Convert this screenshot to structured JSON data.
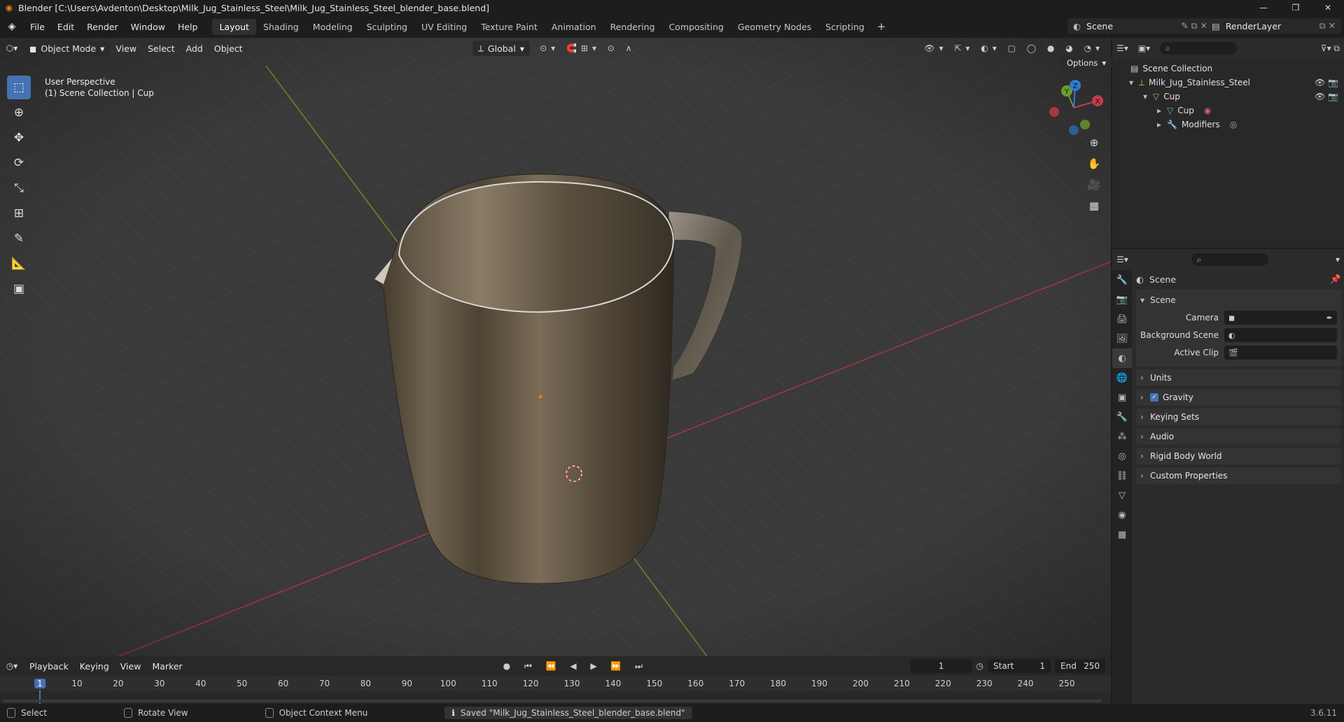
{
  "window": {
    "title": "Blender [C:\\Users\\Avdenton\\Desktop\\Milk_Jug_Stainless_Steel\\Milk_Jug_Stainless_Steel_blender_base.blend]",
    "controls": [
      "—",
      "❐",
      "✕"
    ]
  },
  "menu": [
    "File",
    "Edit",
    "Render",
    "Window",
    "Help"
  ],
  "workspaces": [
    "Layout",
    "Shading",
    "Modeling",
    "Sculpting",
    "UV Editing",
    "Texture Paint",
    "Animation",
    "Rendering",
    "Compositing",
    "Geometry Nodes",
    "Scripting"
  ],
  "active_workspace": "Layout",
  "scene_name": "Scene",
  "view_layer": "RenderLayer",
  "viewport_header": {
    "mode": "Object Mode",
    "menus": [
      "View",
      "Select",
      "Add",
      "Object"
    ],
    "orientation": "Global",
    "options_label": "Options"
  },
  "viewport_overlay": {
    "perspective": "User Perspective",
    "collection": "(1) Scene Collection | Cup"
  },
  "gizmo_axes": {
    "x": "X",
    "y": "Y",
    "z": "Z"
  },
  "outliner": {
    "root": "Scene Collection",
    "items": [
      {
        "label": "Milk_Jug_Stainless_Steel",
        "indent": 1
      },
      {
        "label": "Cup",
        "indent": 2
      },
      {
        "label": "Cup",
        "indent": 3
      },
      {
        "label": "Modifiers",
        "indent": 3
      }
    ]
  },
  "properties": {
    "header": "Scene",
    "section": "Scene",
    "fields": [
      {
        "label": "Camera"
      },
      {
        "label": "Background Scene"
      },
      {
        "label": "Active Clip"
      }
    ],
    "panels": [
      "Units",
      "Gravity",
      "Keying Sets",
      "Audio",
      "Rigid Body World",
      "Custom Properties"
    ]
  },
  "timeline": {
    "menus": [
      "Playback",
      "Keying",
      "View",
      "Marker"
    ],
    "current_frame": "1",
    "start_label": "Start",
    "start": "1",
    "end_label": "End",
    "end": "250",
    "ticks": [
      "1",
      "10",
      "20",
      "30",
      "40",
      "50",
      "60",
      "70",
      "80",
      "90",
      "100",
      "110",
      "120",
      "130",
      "140",
      "150",
      "160",
      "170",
      "180",
      "190",
      "200",
      "210",
      "220",
      "230",
      "240",
      "250"
    ]
  },
  "status": {
    "select": "Select",
    "rotate": "Rotate View",
    "context": "Object Context Menu",
    "message": "Saved \"Milk_Jug_Stainless_Steel_blender_base.blend\"",
    "version": "3.6.11"
  },
  "colors": {
    "accent": "#4772b3",
    "x_axis": "#c43a4b",
    "y_axis": "#6b9b2e",
    "z_axis": "#2f7bd2",
    "origin": "#e87d0d"
  }
}
